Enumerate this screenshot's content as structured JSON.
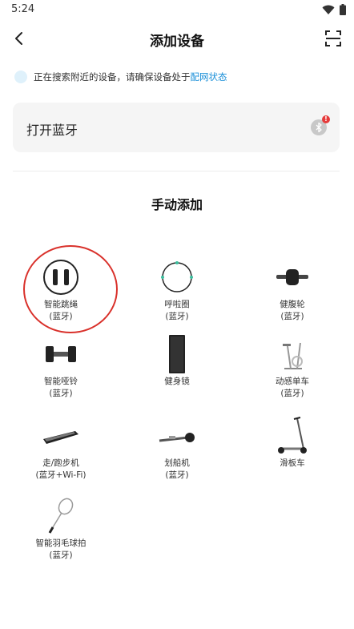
{
  "status": {
    "time": "5:24"
  },
  "nav": {
    "title": "添加设备"
  },
  "tip": {
    "text": "正在搜索附近的设备，请确保设备处于",
    "link": "配网状态"
  },
  "bluetooth": {
    "label": "打开蓝牙",
    "badge": "!"
  },
  "section": {
    "title": "手动添加"
  },
  "devices": [
    {
      "name": "智能跳绳",
      "sub": "(蓝牙)"
    },
    {
      "name": "呼啦圈",
      "sub": "(蓝牙)"
    },
    {
      "name": "健腹轮",
      "sub": "(蓝牙)"
    },
    {
      "name": "智能哑铃",
      "sub": "(蓝牙)"
    },
    {
      "name": "健身镜",
      "sub": ""
    },
    {
      "name": "动感单车",
      "sub": "(蓝牙)"
    },
    {
      "name": "走/跑步机",
      "sub": "(蓝牙+Wi-Fi)"
    },
    {
      "name": "划船机",
      "sub": "(蓝牙)"
    },
    {
      "name": "滑板车",
      "sub": ""
    },
    {
      "name": "智能羽毛球拍",
      "sub": "(蓝牙)"
    }
  ],
  "colors": {
    "accent": "#1a8fd8",
    "highlight": "#d9312b",
    "badge": "#e63b3b"
  }
}
